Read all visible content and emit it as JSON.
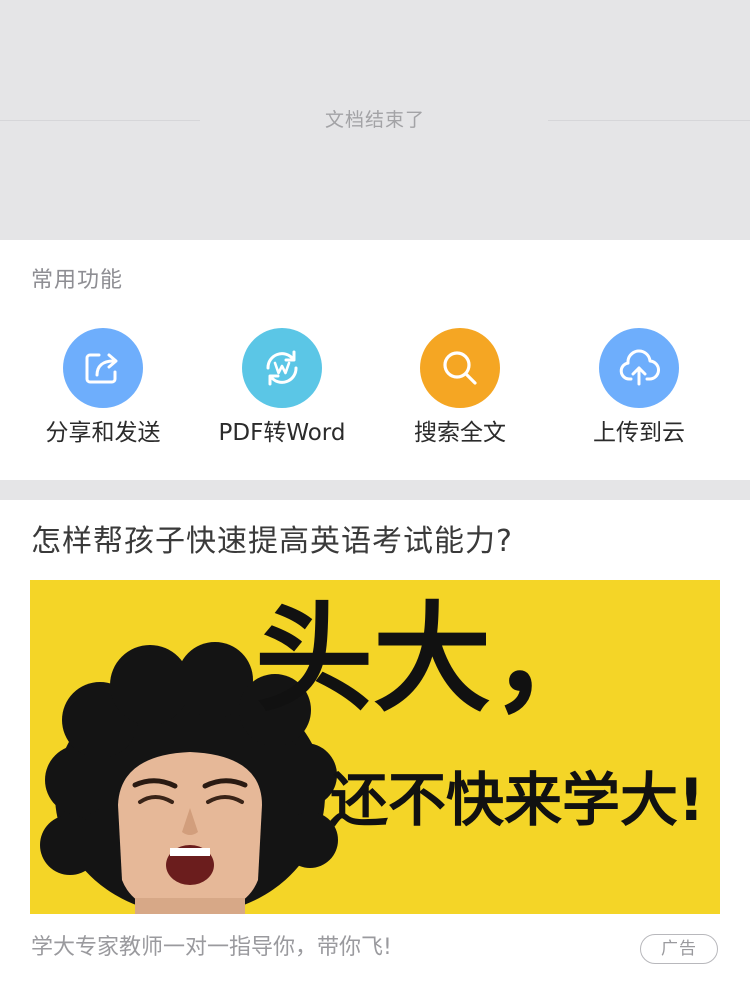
{
  "doc_end": {
    "text": "文档结束了"
  },
  "functions": {
    "title": "常用功能",
    "items": [
      {
        "label": "分享和发送",
        "icon": "share-icon",
        "color": "#6eaefc"
      },
      {
        "label": "PDF转Word",
        "icon": "pdf-to-word-icon",
        "color": "#5bc6e6"
      },
      {
        "label": "搜索全文",
        "icon": "search-icon",
        "color": "#f5a623"
      },
      {
        "label": "上传到云",
        "icon": "cloud-upload-icon",
        "color": "#6eaefc"
      }
    ]
  },
  "ad": {
    "title": "怎样帮孩子快速提高英语考试能力?",
    "image_text_line1": "头大，",
    "image_text_line2": "还不快来学大!",
    "caption": "学大专家教师一对一指导你，带你飞!",
    "badge": "广告",
    "image_background": "#f4d527"
  },
  "colors": {
    "page_gray": "#e5e5e7",
    "accent_blue": "#6eaefc",
    "accent_teal": "#5bc6e6",
    "accent_orange": "#f5a623"
  }
}
